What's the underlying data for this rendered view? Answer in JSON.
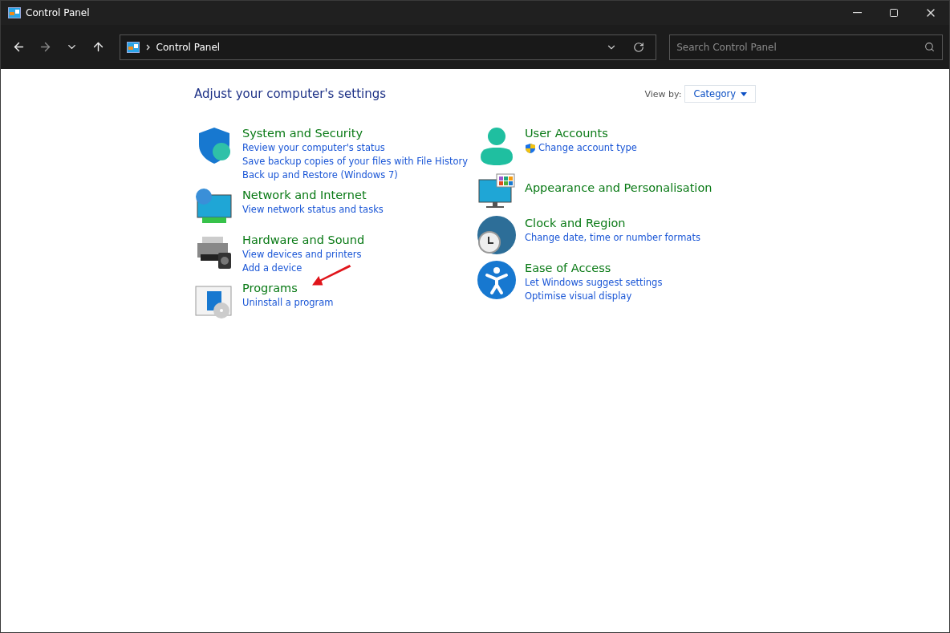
{
  "window": {
    "title": "Control Panel"
  },
  "address_bar": {
    "path": "Control Panel"
  },
  "search": {
    "placeholder": "Search Control Panel"
  },
  "heading": "Adjust your computer's settings",
  "view_by": {
    "label": "View by:",
    "value": "Category"
  },
  "columns": [
    {
      "categories": [
        {
          "title": "System and Security",
          "links": [
            {
              "text": "Review your computer's status",
              "kind": "plain"
            },
            {
              "text": "Save backup copies of your files with File History",
              "kind": "plain"
            },
            {
              "text": "Back up and Restore (Windows 7)",
              "kind": "plain"
            }
          ]
        },
        {
          "title": "Network and Internet",
          "links": [
            {
              "text": "View network status and tasks",
              "kind": "plain"
            }
          ]
        },
        {
          "title": "Hardware and Sound",
          "links": [
            {
              "text": "View devices and printers",
              "kind": "plain"
            },
            {
              "text": "Add a device",
              "kind": "plain"
            }
          ]
        },
        {
          "title": "Programs",
          "links": [
            {
              "text": "Uninstall a program",
              "kind": "plain"
            }
          ]
        }
      ]
    },
    {
      "categories": [
        {
          "title": "User Accounts",
          "links": [
            {
              "text": "Change account type",
              "kind": "elevated"
            }
          ]
        },
        {
          "title": "Appearance and Personalisation"
        },
        {
          "title": "Clock and Region",
          "links": [
            {
              "text": "Change date, time or number formats",
              "kind": "plain"
            }
          ]
        },
        {
          "title": "Ease of Access",
          "links": [
            {
              "text": "Let Windows suggest settings",
              "kind": "plain"
            },
            {
              "text": "Optimise visual display",
              "kind": "plain"
            }
          ]
        }
      ]
    }
  ]
}
